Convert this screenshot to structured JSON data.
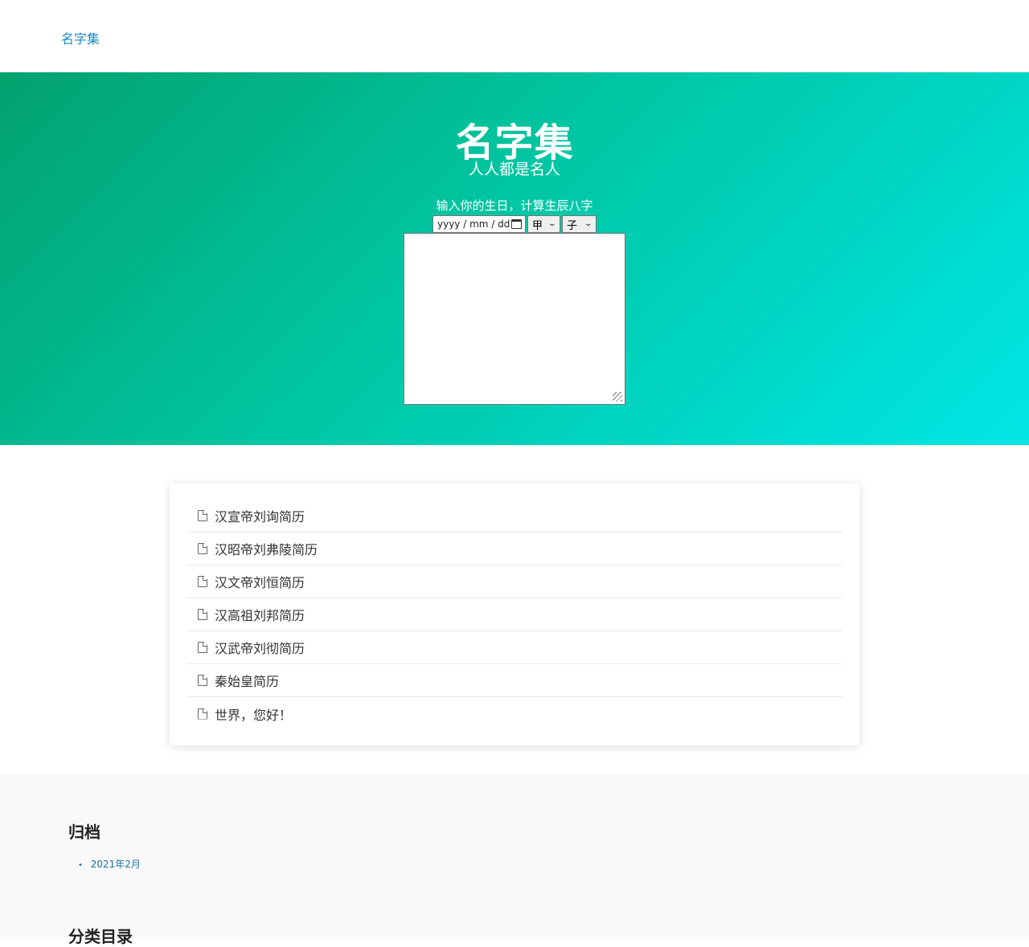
{
  "header": {
    "site_link": "名字集"
  },
  "hero": {
    "title": "名字集",
    "subtitle": "人人都是名人",
    "bazi_prompt": "输入你的生日，计算生辰八字",
    "date_placeholder": "yyyy / mm / dd",
    "stem_selected": "甲",
    "branch_selected": "子"
  },
  "posts": [
    {
      "title": "汉宣帝刘询简历"
    },
    {
      "title": "汉昭帝刘弗陵简历"
    },
    {
      "title": "汉文帝刘恒简历"
    },
    {
      "title": "汉高祖刘邦简历"
    },
    {
      "title": "汉武帝刘彻简历"
    },
    {
      "title": "秦始皇简历"
    },
    {
      "title": "世界，您好！"
    }
  ],
  "footer": {
    "archives_title": "归档",
    "archives": [
      {
        "label": "2021年2月"
      }
    ],
    "categories_title": "分类目录"
  },
  "colors": {
    "link": "#1e8bc3",
    "hero_start": "#03a26f",
    "hero_end": "#00e6e6"
  }
}
